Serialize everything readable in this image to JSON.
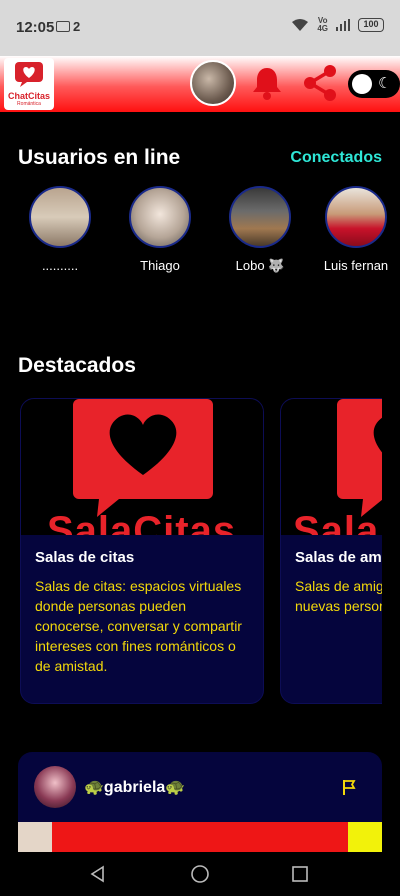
{
  "status_bar": {
    "time": "12:05",
    "notification_count": "2",
    "network": "VoLTE 4G",
    "battery": "100"
  },
  "header": {
    "logo_text": "ChatCitas",
    "logo_subtext": "Romántica",
    "icons": [
      "profile-avatar",
      "bell-icon",
      "share-icon",
      "theme-toggle"
    ]
  },
  "online": {
    "title": "Usuarios en line",
    "link": "Conectados",
    "users": [
      {
        "name": ".........."
      },
      {
        "name": "Thiago"
      },
      {
        "name": "Lobo 🐺"
      },
      {
        "name": "Luis fernan"
      }
    ]
  },
  "featured": {
    "title": "Destacados",
    "cards": [
      {
        "image_text": "SalaCitas",
        "title": "Salas de citas",
        "description": "Salas de citas: espacios virtuales donde personas pueden conocerse, conversar y compartir intereses con fines románticos o de amistad."
      },
      {
        "image_text": "SalaA",
        "title": "Salas de ami",
        "description": "Salas de amig compartir, reír nuevas person"
      }
    ]
  },
  "post": {
    "username": "🐢gabriela🐢"
  },
  "colors": {
    "accent_red": "#e8232a",
    "header_gradient_end": "#ff1010",
    "link_cyan": "#2ee6d6",
    "card_bg": "#05053d",
    "card_text_yellow": "#f3d90a"
  }
}
